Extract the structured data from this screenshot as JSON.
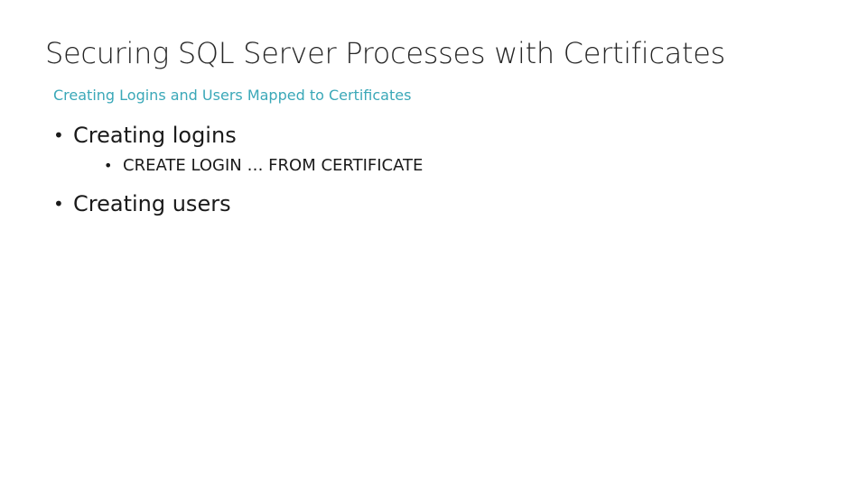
{
  "slide": {
    "title": "Securing SQL Server Processes with Certificates",
    "subtitle": "Creating Logins and Users Mapped to Certificates",
    "bullets": [
      {
        "text": "Creating logins",
        "bullet": "•"
      },
      {
        "text": "CREATE LOGIN … FROM CERTIFICATE",
        "bullet": "•"
      },
      {
        "text": "Creating users",
        "bullet": "•"
      }
    ]
  }
}
